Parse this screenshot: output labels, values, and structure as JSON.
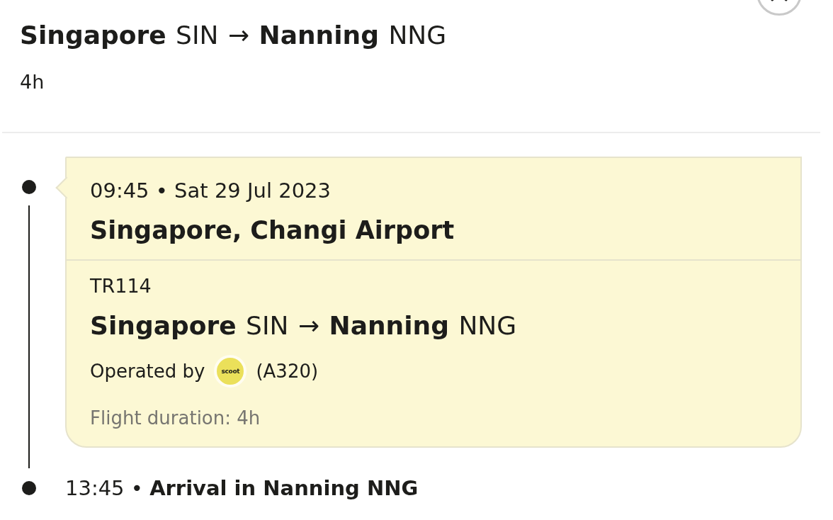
{
  "header": {
    "route": "**Singapore** SIN → **Nanning** NNG",
    "duration": "4h"
  },
  "timeline": {
    "departure": {
      "time_date": "09:45 • Sat 29 Jul 2023",
      "airport": "Singapore, Changi Airport"
    },
    "segment": {
      "flight_number": "TR114",
      "route": "**Singapore** SIN → **Nanning** NNG",
      "operated_by": "Operated by",
      "airline_logo": "scoot",
      "aircraft": "(A320)",
      "duration": "Flight duration: 4h"
    },
    "arrival": {
      "text": "13:45 • **Arrival in Nanning NNG**"
    }
  }
}
